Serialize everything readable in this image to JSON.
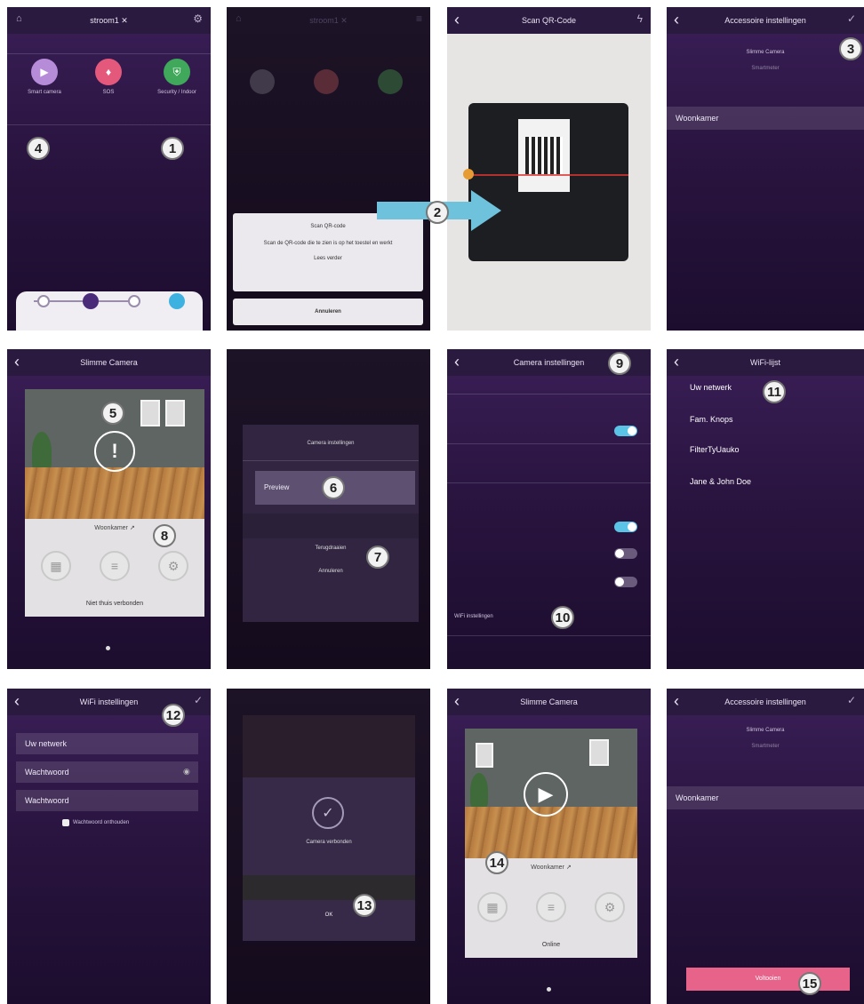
{
  "screens": {
    "s1": {
      "title": "stroom1 ✕",
      "tile1": "Smart camera",
      "tile2": "SOS",
      "tile3": "Security / Indoor"
    },
    "s2": {
      "title": "stroom1 ✕",
      "dialog_title": "Scan QR-code",
      "dialog_body": "Scan de QR-code die te zien is op het toestel en werkt",
      "dialog_link": "Lees verder",
      "cancel": "Annuleren"
    },
    "s3": {
      "title": "Scan QR-Code"
    },
    "s4": {
      "title": "Accessoire instellingen",
      "device_name": "Slimme Camera",
      "device_sub": "Smartmeter",
      "room": "Woonkamer"
    },
    "s5": {
      "title": "Slimme Camera",
      "room": "Woonkamer ↗",
      "status": "Niet thuis verbonden"
    },
    "s6": {
      "dialog_title": "Camera instellingen",
      "option_selected": "Preview",
      "option_a": "Terugdraaien",
      "option_b": "Annuleren"
    },
    "s7": {
      "title": "Camera instellingen",
      "wifi_settings": "WiFi instellingen"
    },
    "s8": {
      "title": "WiFi-lijst",
      "items": [
        "Uw netwerk",
        "Fam. Knops",
        "FilterTyUauko",
        "Jane & John Doe"
      ]
    },
    "s9": {
      "title": "WiFi instellingen",
      "network": "Uw netwerk",
      "password": "Wachtwoord",
      "password2": "Wachtwoord",
      "checkbox": "Wachtwoord onthouden"
    },
    "s10": {
      "message": "Camera verbonden",
      "ok": "OK"
    },
    "s11": {
      "title": "Slimme Camera",
      "room": "Woonkamer ↗",
      "status": "Online"
    },
    "s12": {
      "title": "Accessoire instellingen",
      "device_name": "Slimme Camera",
      "device_sub": "Smartmeter",
      "room": "Woonkamer",
      "save": "Voltooien"
    }
  },
  "step_numbers": [
    "1",
    "2",
    "3",
    "4",
    "5",
    "6",
    "7",
    "8",
    "9",
    "10",
    "11",
    "12",
    "13",
    "14",
    "15"
  ]
}
